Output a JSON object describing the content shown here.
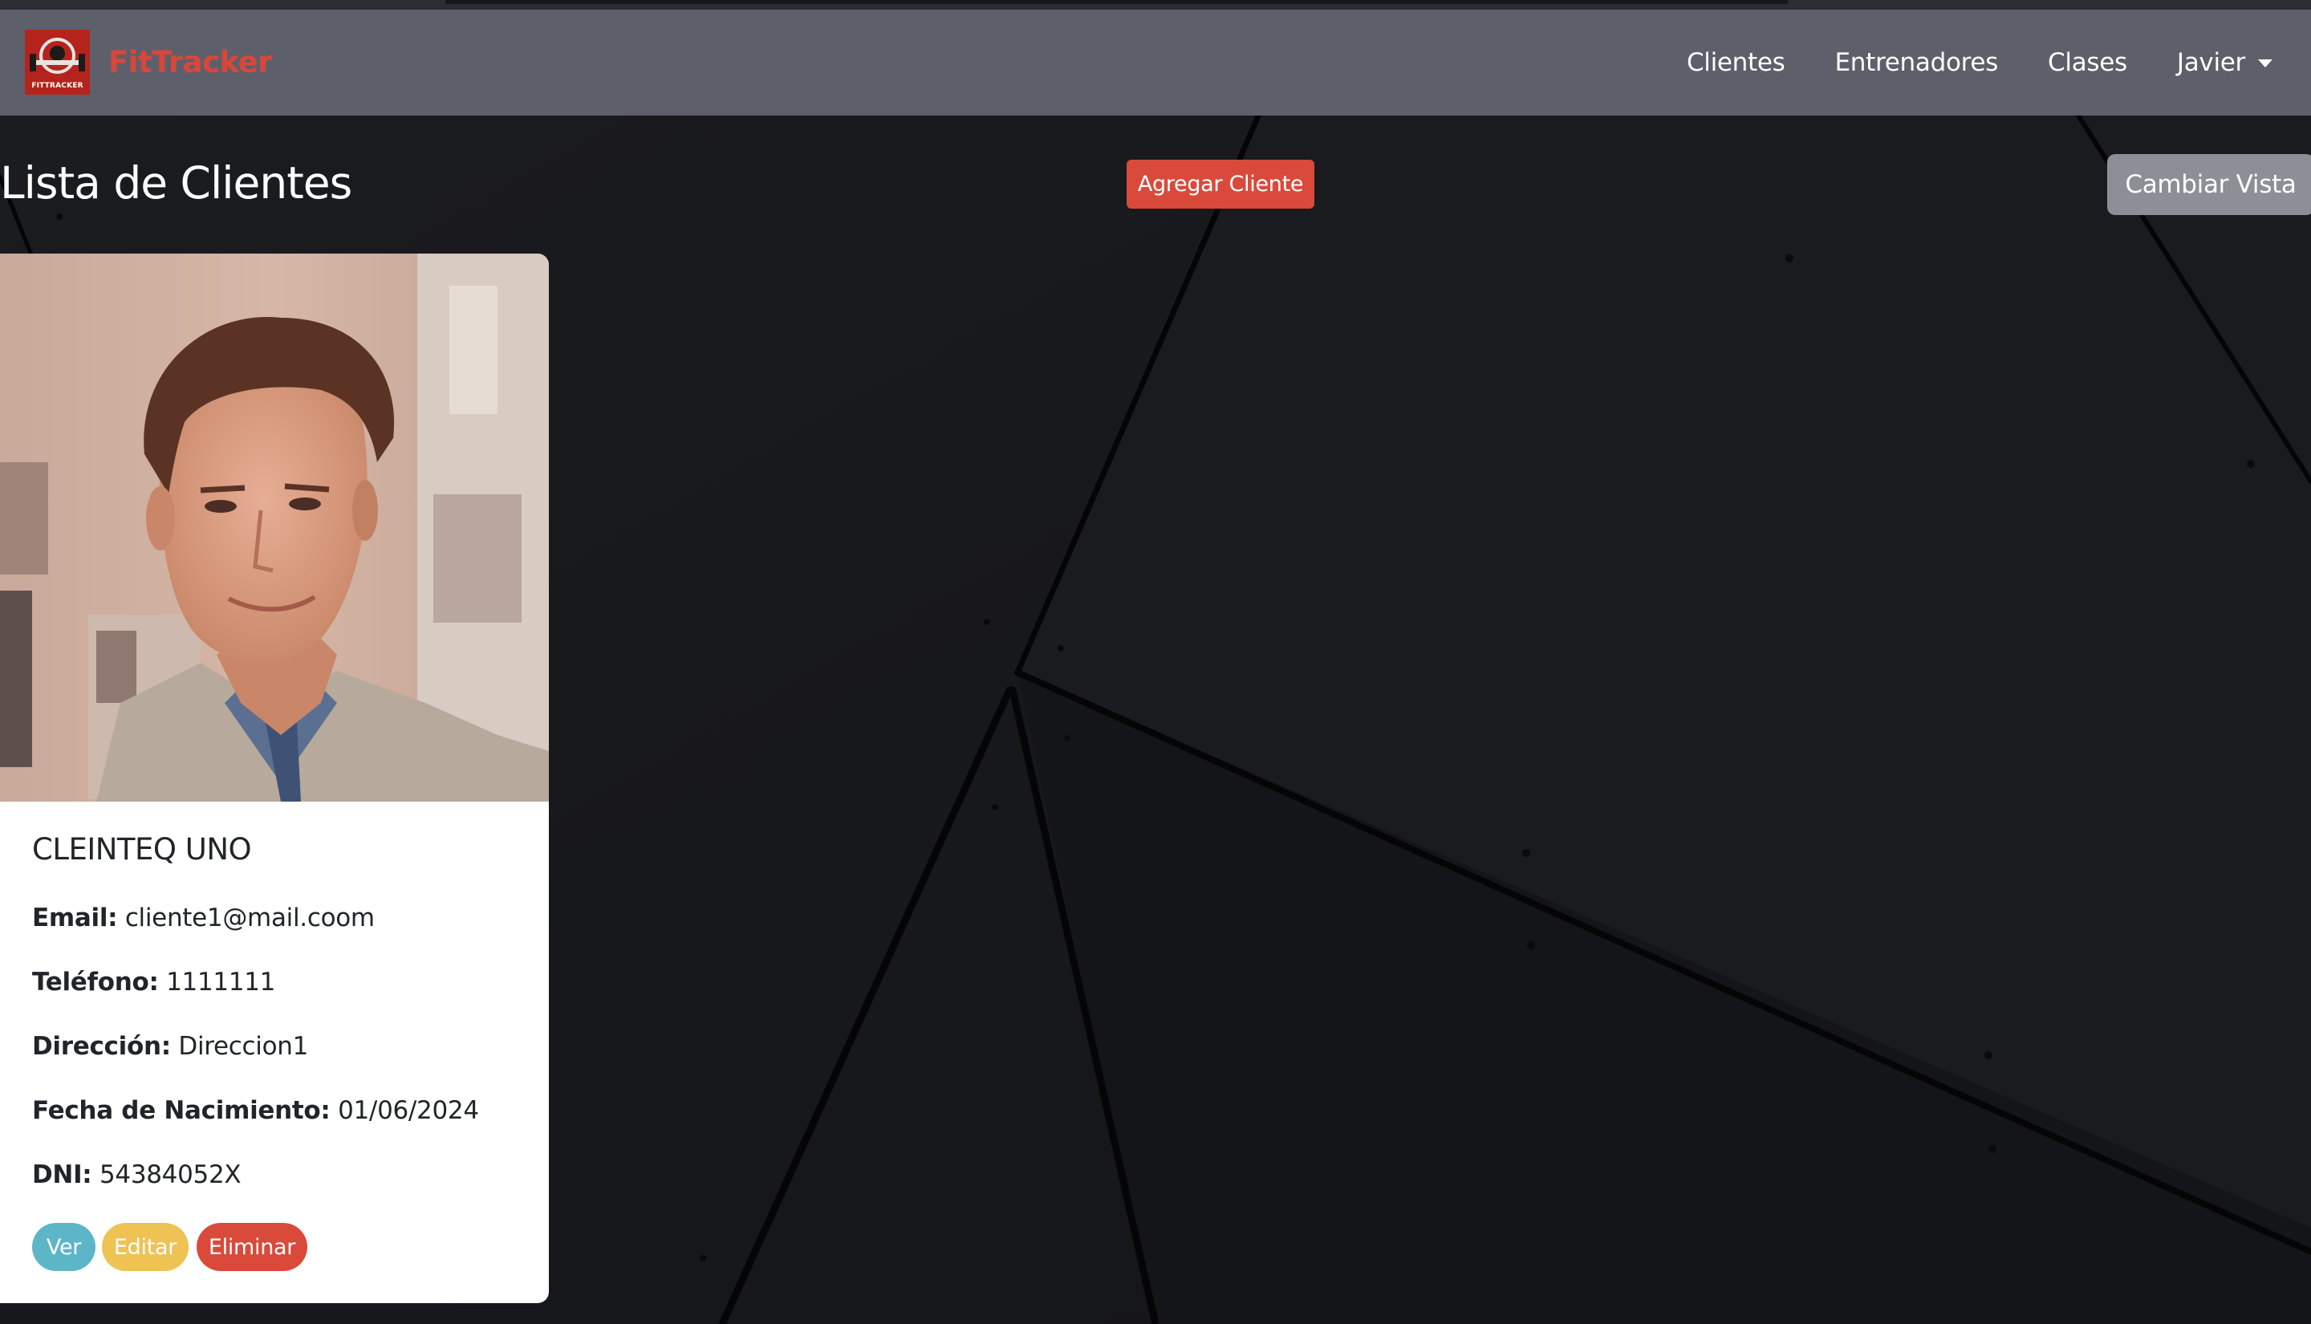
{
  "brand": {
    "name": "FitTracker",
    "logo_text": "FITTRACKER",
    "logo_color": "#b5241c",
    "name_color": "#d9463a"
  },
  "navbar": {
    "links": [
      "Clientes",
      "Entrenadores",
      "Clases"
    ],
    "user": "Javier",
    "background": "#5d606b"
  },
  "page": {
    "title": "Lista de Clientes",
    "add_button": "Agregar Cliente",
    "view_button": "Cambiar Vista"
  },
  "clients": [
    {
      "name": "CLEINTEQ UNO",
      "fields": [
        {
          "label": "Email:",
          "value": "cliente1@mail.coom"
        },
        {
          "label": "Teléfono:",
          "value": "1111111"
        },
        {
          "label": "Dirección:",
          "value": "Direccion1"
        },
        {
          "label": "Fecha de Nacimiento:",
          "value": "01/06/2024"
        },
        {
          "label": "DNI:",
          "value": "54384052X"
        }
      ],
      "actions": [
        "Ver",
        "Editar",
        "Eliminar"
      ]
    }
  ],
  "colors": {
    "danger": "#d94a3b",
    "info": "#5db6c8",
    "warning": "#eec353",
    "secondary": "#8d8f97",
    "background": "#17181c"
  }
}
